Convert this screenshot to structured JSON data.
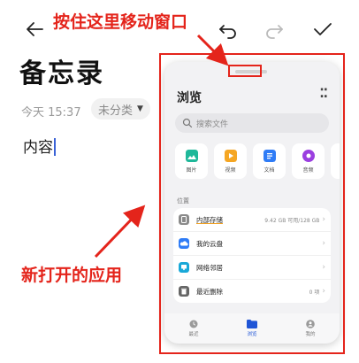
{
  "toolbar": {
    "back_icon": "back-arrow-icon",
    "undo_icon": "undo-icon",
    "redo_icon": "redo-icon",
    "confirm_icon": "checkmark-icon"
  },
  "note": {
    "title": "备忘录",
    "timestamp": "今天 15:37",
    "category": "未分类",
    "body": "内容"
  },
  "annotations": {
    "drag_hint": "按住这里移动窗口",
    "new_app_hint": "新打开的应用",
    "color": "#e4241b"
  },
  "floating_window": {
    "title": "浏览",
    "search_placeholder": "搜索文件",
    "categories": [
      {
        "label": "图片",
        "icon": "image-icon",
        "color": "#1fb89a"
      },
      {
        "label": "视频",
        "icon": "video-icon",
        "color": "#f5a623"
      },
      {
        "label": "文档",
        "icon": "document-icon",
        "color": "#2f7cf6"
      },
      {
        "label": "音频",
        "icon": "audio-icon",
        "color": "#9b3fe0"
      }
    ],
    "locations_label": "位置",
    "locations": [
      {
        "name": "内部存储",
        "value": "9.42 GB 可用/128 GB",
        "icon": "phone-storage-icon",
        "color": "#8a8a8a"
      },
      {
        "name": "我的云盘",
        "value": "",
        "icon": "cloud-icon",
        "color": "#2f7cf6"
      },
      {
        "name": "网络邻居",
        "value": "",
        "icon": "network-icon",
        "color": "#19a8d8"
      },
      {
        "name": "最近删除",
        "value": "0 项",
        "icon": "trash-icon",
        "color": "#666666"
      }
    ],
    "nav": [
      {
        "label": "最近",
        "icon": "clock-icon"
      },
      {
        "label": "浏览",
        "icon": "folder-icon",
        "active": true
      },
      {
        "label": "我的",
        "icon": "profile-icon"
      }
    ],
    "accent": "#1f55d6"
  }
}
